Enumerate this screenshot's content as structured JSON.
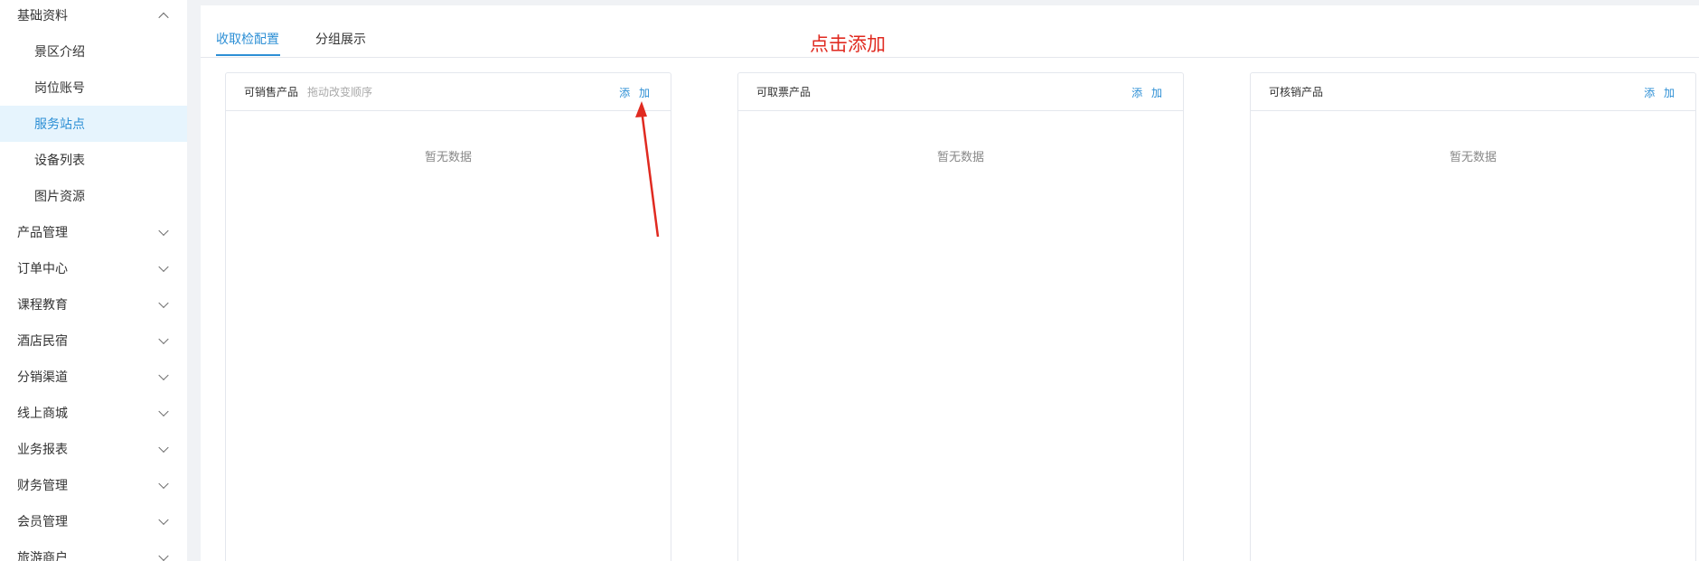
{
  "sidebar": {
    "groups": [
      {
        "label": "基础资料",
        "expanded": true
      },
      {
        "label": "产品管理"
      },
      {
        "label": "订单中心"
      },
      {
        "label": "课程教育"
      },
      {
        "label": "酒店民宿"
      },
      {
        "label": "分销渠道"
      },
      {
        "label": "线上商城"
      },
      {
        "label": "业务报表"
      },
      {
        "label": "财务管理"
      },
      {
        "label": "会员管理"
      },
      {
        "label": "旅游商户"
      }
    ],
    "sub_items": [
      {
        "label": "景区介绍"
      },
      {
        "label": "岗位账号"
      },
      {
        "label": "服务站点",
        "active": true
      },
      {
        "label": "设备列表"
      },
      {
        "label": "图片资源"
      }
    ]
  },
  "tabs": [
    {
      "label": "收取检配置",
      "active": true
    },
    {
      "label": "分组展示"
    }
  ],
  "annotation": {
    "text": "点击添加",
    "color": "#e02a20"
  },
  "cards": [
    {
      "title": "可销售产品",
      "hint": "拖动改变顺序",
      "add_label": "添 加",
      "empty_text": "暂无数据"
    },
    {
      "title": "可取票产品",
      "hint": "",
      "add_label": "添 加",
      "empty_text": "暂无数据"
    },
    {
      "title": "可核销产品",
      "hint": "",
      "add_label": "添 加",
      "empty_text": "暂无数据"
    }
  ],
  "colors": {
    "accent": "#2d8fd5",
    "active_bg": "#e6f4fd",
    "annotation": "#e02a20"
  }
}
